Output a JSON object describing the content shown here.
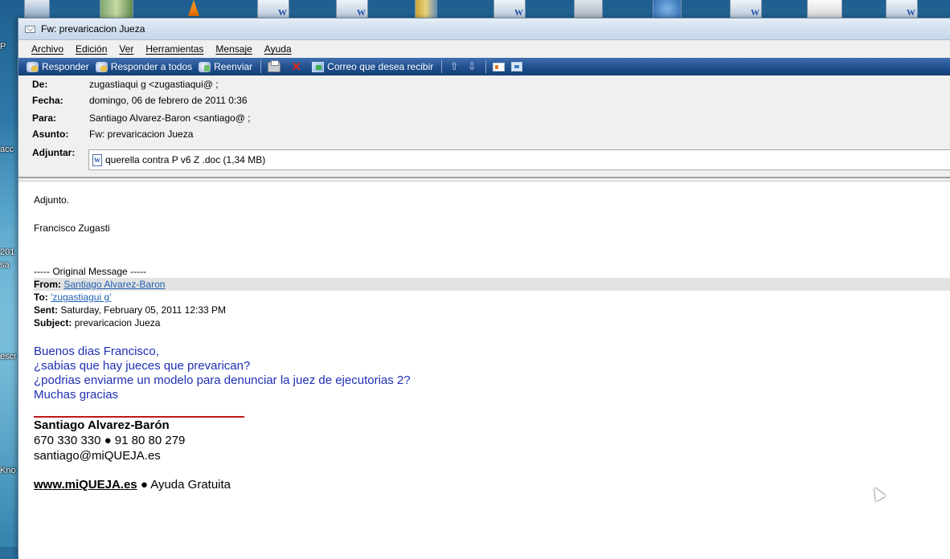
{
  "window": {
    "title": "Fw: prevaricacion Jueza"
  },
  "desktop": {
    "side_labels": [
      "P",
      "acc",
      "201",
      "sa",
      "escr",
      "Kno"
    ]
  },
  "menu": [
    {
      "label": "Archivo"
    },
    {
      "label": "Edición"
    },
    {
      "label": "Ver"
    },
    {
      "label": "Herramientas"
    },
    {
      "label": "Mensaje"
    },
    {
      "label": "Ayuda"
    }
  ],
  "toolbar": {
    "reply": "Responder",
    "reply_all": "Responder a todos",
    "forward": "Reenviar",
    "junk": "Correo que desea recibir"
  },
  "headers": {
    "from_label": "De:",
    "from_value": "zugastiaqui g <zugastiaqui@ ;",
    "date_label": "Fecha:",
    "date_value": "domingo, 06 de febrero de 2011 0:36",
    "to_label": "Para:",
    "to_value": "Santiago Alvarez-Baron <santiago@ ;",
    "subject_label": "Asunto:",
    "subject_value": "Fw: prevaricacion Jueza",
    "attach_label": "Adjuntar:",
    "attachment": "querella contra P v6 Z .doc (1,34 MB)"
  },
  "body": {
    "line1": "Adjunto.",
    "line2": "Francisco Zugasti",
    "original_header": "----- Original Message -----",
    "orig_from_label": "From:",
    "orig_from_value": "Santiago Alvarez-Baron",
    "orig_to_label": "To:",
    "orig_to_value": "'zugastiagui g'",
    "orig_sent_label": "Sent:",
    "orig_sent_value": "Saturday, February 05, 2011 12:33 PM",
    "orig_subject_label": "Subject:",
    "orig_subject_value": "prevaricacion Jueza",
    "msg1": "Buenos dias Francisco,",
    "msg2": "¿sabias que hay jueces que prevarican?",
    "msg3": "¿podrias enviarme un modelo para denunciar la juez de ejecutorias 2?",
    "msg4": "Muchas gracias",
    "sig_name": "Santiago Alvarez-Barón",
    "sig_phones": "670 330 330 ● 91 80 80 279",
    "sig_email": "santiago@miQUEJA.es",
    "sig_web": "www.miQUEJA.es",
    "sig_tagline": "● Ayuda Gratuita"
  }
}
